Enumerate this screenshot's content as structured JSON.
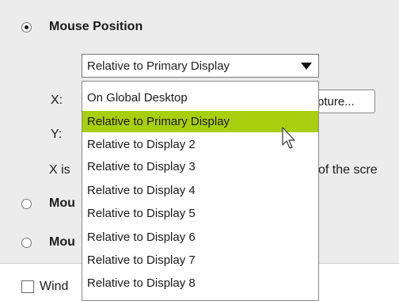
{
  "mouse_position": {
    "label": "Mouse Position",
    "selected": true,
    "combo_value": "Relative to Primary Display",
    "x_label": "X:",
    "y_label": "Y:",
    "capture_button": "pture...",
    "note_left": "X is",
    "note_right": "of the scre"
  },
  "option2": {
    "label_partial": "Mou",
    "selected": false
  },
  "option3": {
    "label_partial": "Mou",
    "selected": false
  },
  "window_checkbox": {
    "label_partial": "Wind",
    "checked": false
  },
  "dropdown": {
    "options": [
      "On Global Desktop",
      "Relative to Primary Display",
      "Relative to Display 2",
      "Relative to Display 3",
      "Relative to Display 4",
      "Relative to Display 5",
      "Relative to Display 6",
      "Relative to Display 7",
      "Relative to Display 8"
    ],
    "selected_index": 1
  },
  "colors": {
    "highlight": "#a8cf0e",
    "panel": "#ececec"
  }
}
